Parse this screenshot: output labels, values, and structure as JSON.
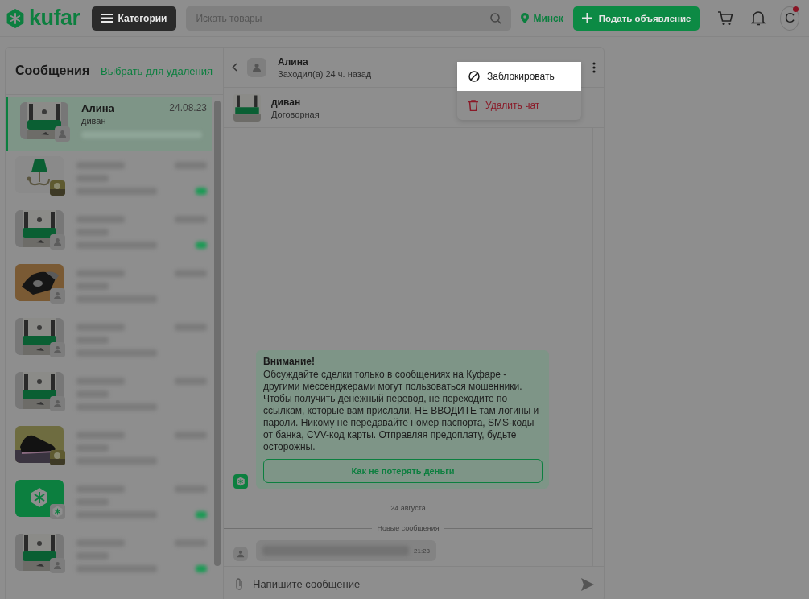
{
  "header": {
    "logo": "kufar",
    "categories_button": "Категории",
    "search": {
      "placeholder": "Искать товары"
    },
    "location": "Минск",
    "post_button": "Подать объявление",
    "avatar": {
      "letter": "С",
      "notification": true
    }
  },
  "sidebar": {
    "title": "Сообщения",
    "select_link": "Выбрать для удаления",
    "chats": [
      {
        "name": "Алина",
        "item": "диван",
        "date": "24.08.23",
        "selected": true,
        "kind": "sofa",
        "badge": {
          "kind": "user"
        }
      },
      {
        "selected": false,
        "kind": "lamp",
        "unread": true
      },
      {
        "selected": false,
        "kind": "sofa",
        "badge": {
          "kind": "user"
        },
        "unread": true
      },
      {
        "selected": false,
        "kind": "iron",
        "badge": {
          "kind": "user"
        },
        "unread": false
      },
      {
        "selected": false,
        "kind": "sofa",
        "badge": {
          "kind": "user"
        },
        "unread": false
      },
      {
        "selected": false,
        "kind": "sofa",
        "badge": {
          "kind": "user"
        },
        "unread": false
      },
      {
        "selected": false,
        "kind": "shoes",
        "unread": false
      },
      {
        "selected": false,
        "kind": "logo",
        "badge": {
          "kind": "logo"
        },
        "unread": true
      },
      {
        "selected": false,
        "kind": "sofa",
        "badge": {
          "kind": "user"
        },
        "unread": true
      }
    ]
  },
  "chat": {
    "contact": {
      "name": "Алина",
      "status": "Заходил(а) 24 ч. назад"
    },
    "listing": {
      "title": "диван",
      "price": "Договорная"
    },
    "menu": {
      "items": [
        {
          "kind": "block",
          "label": "Заблокировать",
          "highlighted": true
        },
        {
          "kind": "delete",
          "label": "Удалить чат",
          "highlighted": false
        }
      ]
    },
    "notice": {
      "title": "Внимание!",
      "body": "Обсуждайте сделки только в сообщениях на Куфаре - другими мессенджерами могут пользоваться мошенники. Чтобы получить денежный перевод, не переходите по ссылкам, которые вам прислали, НЕ ВВОДИТЕ там логины и пароли. Никому не передавайте номер паспорта, SMS-коды от банка, CVV-код карты. Отправляя предоплату, будьте осторожны.",
      "button": "Как не потерять деньги"
    },
    "date_divider": "24 августа",
    "new_divider": "Новые сообщения",
    "messages": [
      {
        "time": "21:23"
      }
    ],
    "input": {
      "placeholder": "Напишите сообщение"
    }
  }
}
